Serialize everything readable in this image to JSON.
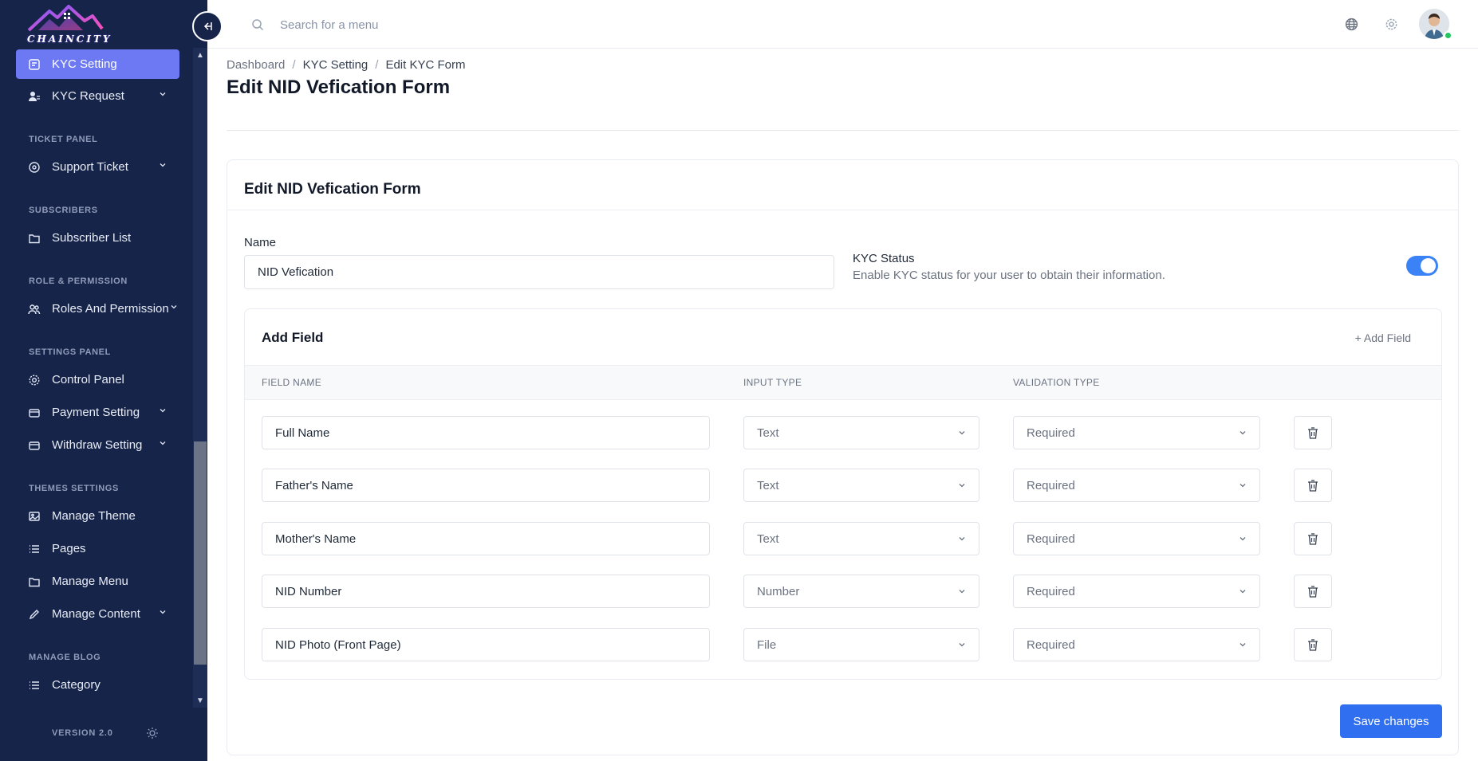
{
  "brand": {
    "logo_text": "CHAINCITY",
    "accent": "#6d79f3",
    "sidebar_bg": "#16244a",
    "primary": "#2f6ff0"
  },
  "sidebar": {
    "items": [
      {
        "label": "KYC Setting",
        "icon": "document-icon",
        "active": true,
        "expandable": false
      },
      {
        "label": "KYC Request",
        "icon": "users-icon",
        "active": false,
        "expandable": true
      },
      {
        "label": "Support Ticket",
        "icon": "headset-icon",
        "active": false,
        "expandable": true
      },
      {
        "label": "Subscriber List",
        "icon": "folder-icon",
        "active": false,
        "expandable": false
      },
      {
        "label": "Roles And Permission",
        "icon": "users-icon",
        "active": false,
        "expandable": true
      },
      {
        "label": "Control Panel",
        "icon": "gear-icon",
        "active": false,
        "expandable": false
      },
      {
        "label": "Payment Setting",
        "icon": "wallet-icon",
        "active": false,
        "expandable": true
      },
      {
        "label": "Withdraw Setting",
        "icon": "wallet-icon",
        "active": false,
        "expandable": true
      },
      {
        "label": "Manage Theme",
        "icon": "image-icon",
        "active": false,
        "expandable": false
      },
      {
        "label": "Pages",
        "icon": "list-icon",
        "active": false,
        "expandable": false
      },
      {
        "label": "Manage Menu",
        "icon": "folder-icon",
        "active": false,
        "expandable": false
      },
      {
        "label": "Manage Content",
        "icon": "pencil-icon",
        "active": false,
        "expandable": true
      },
      {
        "label": "Category",
        "icon": "list-icon",
        "active": false,
        "expandable": false
      }
    ],
    "sections": [
      "TICKET PANEL",
      "SUBSCRIBERS",
      "ROLE & PERMISSION",
      "SETTINGS PANEL",
      "THEMES SETTINGS",
      "MANAGE BLOG"
    ],
    "version": "VERSION 2.0"
  },
  "topbar": {
    "search_placeholder": "Search for a menu"
  },
  "breadcrumb": [
    "Dashboard",
    "KYC Setting",
    "Edit KYC Form"
  ],
  "page_title": "Edit NID Vefication Form",
  "form": {
    "card_title": "Edit NID Vefication Form",
    "name_label": "Name",
    "name_value": "NID Vefication",
    "kyc_status_title": "KYC Status",
    "kyc_status_desc": "Enable KYC status for your user to obtain their information.",
    "kyc_status_on": true,
    "add_field_title": "Add Field",
    "add_field_link": "+ Add Field",
    "columns": [
      "FIELD NAME",
      "INPUT TYPE",
      "VALIDATION TYPE"
    ],
    "rows": [
      {
        "field_name": "Full Name",
        "input_type": "Text",
        "validation": "Required"
      },
      {
        "field_name": "Father's Name",
        "input_type": "Text",
        "validation": "Required"
      },
      {
        "field_name": "Mother's Name",
        "input_type": "Text",
        "validation": "Required"
      },
      {
        "field_name": "NID Number",
        "input_type": "Number",
        "validation": "Required"
      },
      {
        "field_name": "NID Photo (Front Page)",
        "input_type": "File",
        "validation": "Required"
      }
    ],
    "save_label": "Save changes"
  }
}
